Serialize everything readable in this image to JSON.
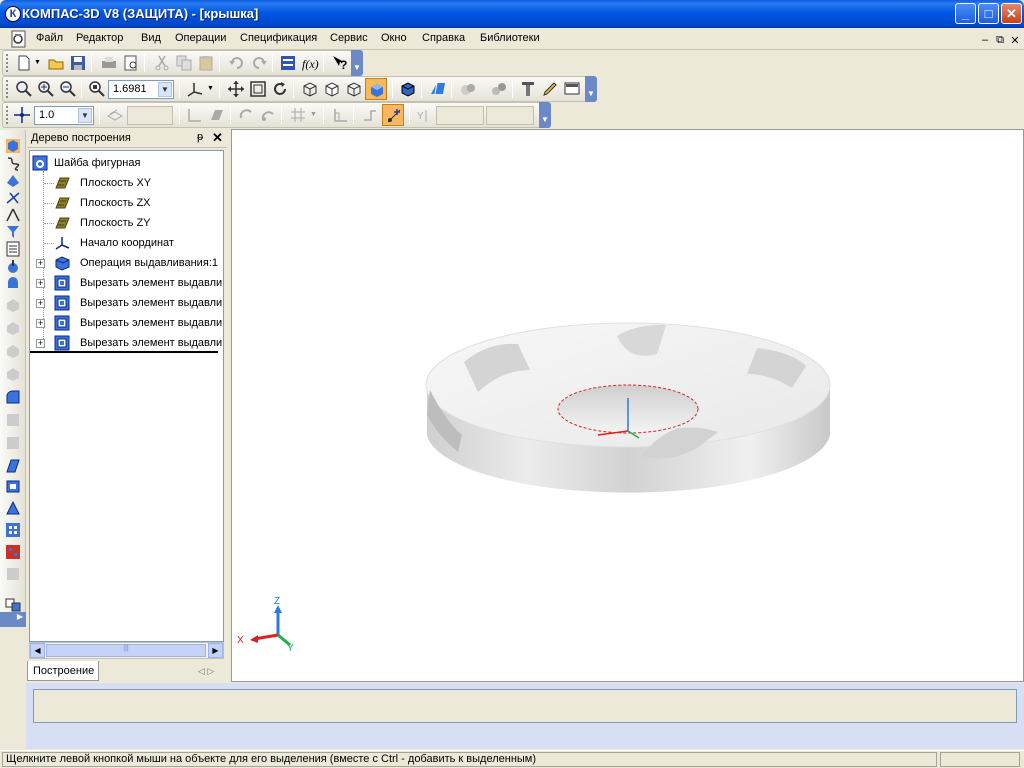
{
  "window": {
    "title": "КОМПАС-3D V8 (ЗАЩИТА) - [крышка]",
    "app_icon_letter": "К",
    "buttons": {
      "minimize": "_",
      "maximize": "□",
      "close": "✕"
    }
  },
  "menu": {
    "items": [
      "Файл",
      "Редактор",
      "Вид",
      "Операции",
      "Спецификация",
      "Сервис",
      "Окно",
      "Справка",
      "Библиотеки"
    ],
    "mdi_controls": [
      "–",
      "⧉",
      "✕"
    ]
  },
  "toolbar_view": {
    "zoom_value": "1.6981"
  },
  "toolbar_current": {
    "step_value": "1.0"
  },
  "tree": {
    "header_title": "Дерево построения",
    "pin_glyph": "ᵽ",
    "close_glyph": "✕",
    "root": "Шайба фигурная",
    "items": [
      {
        "label": "Плоскость XY",
        "icon": "plane-icon",
        "expandable": false
      },
      {
        "label": "Плоскость ZX",
        "icon": "plane-icon",
        "expandable": false
      },
      {
        "label": "Плоскость ZY",
        "icon": "plane-icon",
        "expandable": false
      },
      {
        "label": "Начало координат",
        "icon": "origin-icon",
        "expandable": false
      },
      {
        "label": "Операция выдавливания:1",
        "icon": "extrude-icon",
        "expandable": true
      },
      {
        "label": "Вырезать элемент выдавли",
        "icon": "cut-extrude-icon",
        "expandable": true
      },
      {
        "label": "Вырезать элемент выдавли",
        "icon": "cut-extrude-icon",
        "expandable": true
      },
      {
        "label": "Вырезать элемент выдавли",
        "icon": "cut-extrude-icon",
        "expandable": true
      },
      {
        "label": "Вырезать элемент выдавли",
        "icon": "cut-extrude-icon",
        "expandable": true
      }
    ],
    "tab_label": "Построение",
    "tab_nav": "◁ ▷",
    "scroll_grip": "|||"
  },
  "axes": {
    "x": "X",
    "y": "Y",
    "z": "Z"
  },
  "status_text": "Щелкните левой кнопкой мыши на объекте для его выделения (вместе с Ctrl - добавить к выделенным)"
}
